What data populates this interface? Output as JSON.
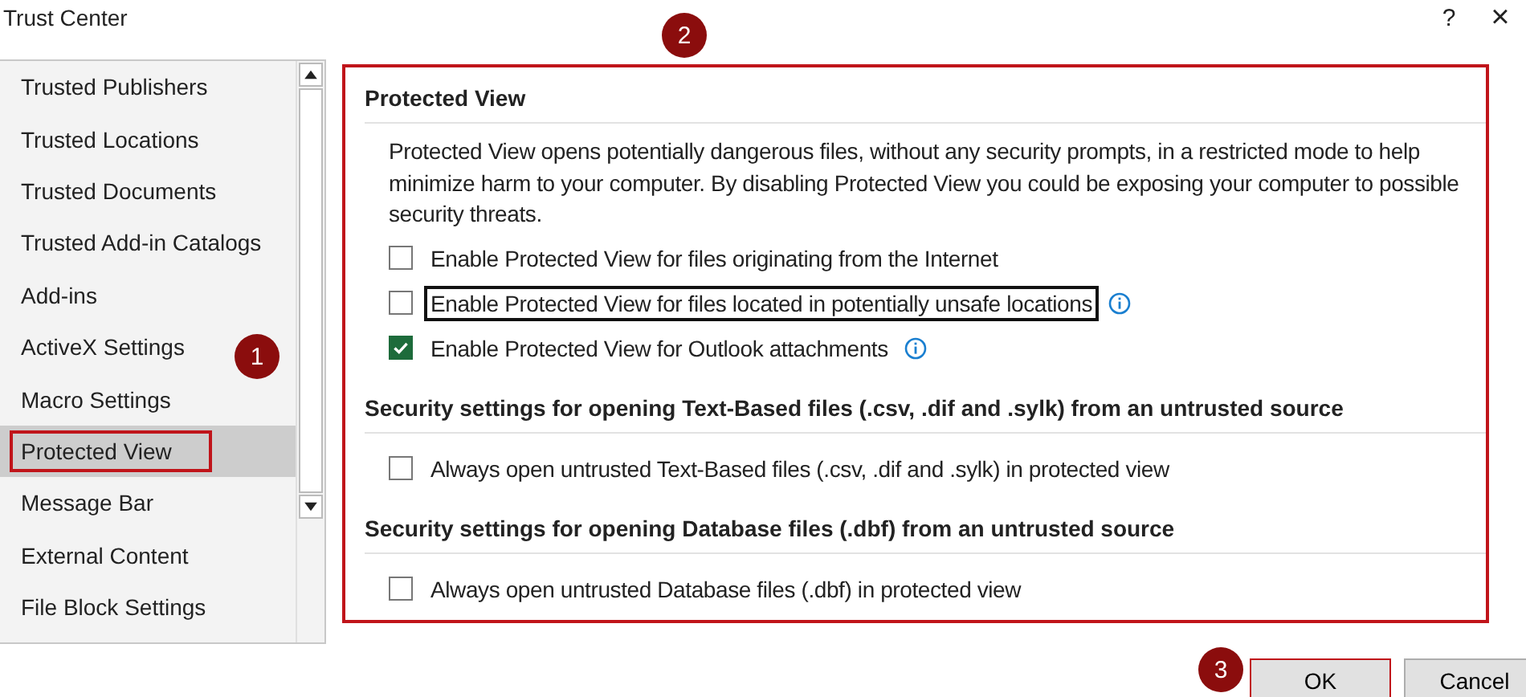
{
  "window": {
    "title": "Trust Center",
    "help": "?",
    "close": "×"
  },
  "sidebar": {
    "items": [
      {
        "label": "Trusted Publishers",
        "selected": false,
        "highlighted": false
      },
      {
        "label": "Trusted Locations",
        "selected": false,
        "highlighted": false
      },
      {
        "label": "Trusted Documents",
        "selected": false,
        "highlighted": false
      },
      {
        "label": "Trusted Add-in Catalogs",
        "selected": false,
        "highlighted": false
      },
      {
        "label": "Add-ins",
        "selected": false,
        "highlighted": false
      },
      {
        "label": "ActiveX Settings",
        "selected": false,
        "highlighted": false
      },
      {
        "label": "Macro Settings",
        "selected": false,
        "highlighted": false
      },
      {
        "label": "Protected View",
        "selected": true,
        "highlighted": true
      },
      {
        "label": "Message Bar",
        "selected": false,
        "highlighted": false
      },
      {
        "label": "External Content",
        "selected": false,
        "highlighted": false
      },
      {
        "label": "File Block Settings",
        "selected": false,
        "highlighted": false
      }
    ]
  },
  "content": {
    "highlighted": true,
    "sections": [
      {
        "heading": "Protected View",
        "description": "Protected View opens potentially dangerous files, without any security prompts, in a restricted mode to help minimize harm to your computer. By disabling Protected View you could be exposing your computer to possible security threats.",
        "options": [
          {
            "label": "Enable Protected View for files originating from the Internet",
            "checked": false,
            "focused": false,
            "info": false
          },
          {
            "label": "Enable Protected View for files located in potentially unsafe locations",
            "checked": false,
            "focused": true,
            "info": true
          },
          {
            "label": "Enable Protected View for Outlook attachments",
            "checked": true,
            "focused": false,
            "info": true
          }
        ]
      },
      {
        "heading": "Security settings for opening Text-Based files (.csv, .dif and .sylk) from an untrusted source",
        "options": [
          {
            "label": "Always open untrusted Text-Based files (.csv, .dif and .sylk) in protected view",
            "checked": false,
            "focused": false,
            "info": false
          }
        ]
      },
      {
        "heading": "Security settings for opening Database files (.dbf) from an untrusted source",
        "options": [
          {
            "label": "Always open untrusted Database files (.dbf) in protected view",
            "checked": false,
            "focused": false,
            "info": false
          }
        ]
      }
    ]
  },
  "buttons": [
    {
      "label": "OK",
      "highlighted": true
    },
    {
      "label": "Cancel",
      "highlighted": false
    }
  ],
  "callouts": [
    {
      "number": "1"
    },
    {
      "number": "2"
    },
    {
      "number": "3"
    }
  ]
}
